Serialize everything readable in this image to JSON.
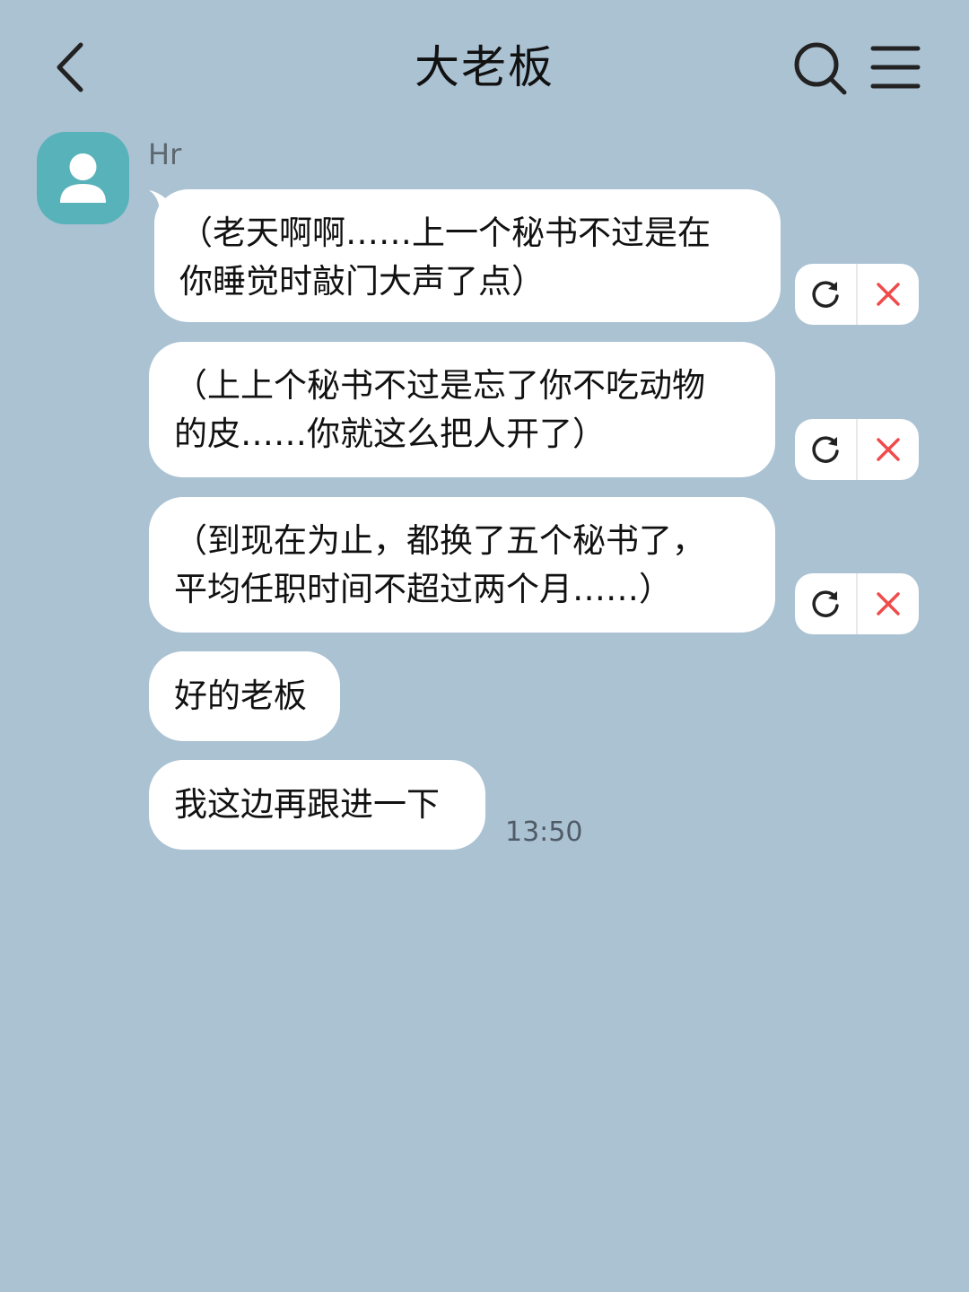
{
  "header": {
    "title": "大老板",
    "back_icon": "chevron-left-icon",
    "search_icon": "search-icon",
    "menu_icon": "menu-icon"
  },
  "sender": {
    "name": "Hr",
    "avatar_icon": "person-icon",
    "avatar_color": "#57b2ba"
  },
  "messages": [
    {
      "line1": "（老天啊啊……上一个秘书不过是在",
      "line2": "你睡觉时敲门大声了点）"
    },
    {
      "line1": "（上上个秘书不过是忘了你不吃动物",
      "line2": "的皮……你就这么把人开了）"
    },
    {
      "line1": "（到现在为止，都换了五个秘书了，",
      "line2": "平均任职时间不超过两个月……）"
    },
    {
      "line1": "好的老板"
    },
    {
      "line1": "我这边再跟进一下"
    }
  ],
  "timestamp": "13:50",
  "colors": {
    "background": "#abc2d3",
    "bubble": "#ffffff",
    "retry_icon": "#222222",
    "delete_icon": "#f04b4b"
  }
}
